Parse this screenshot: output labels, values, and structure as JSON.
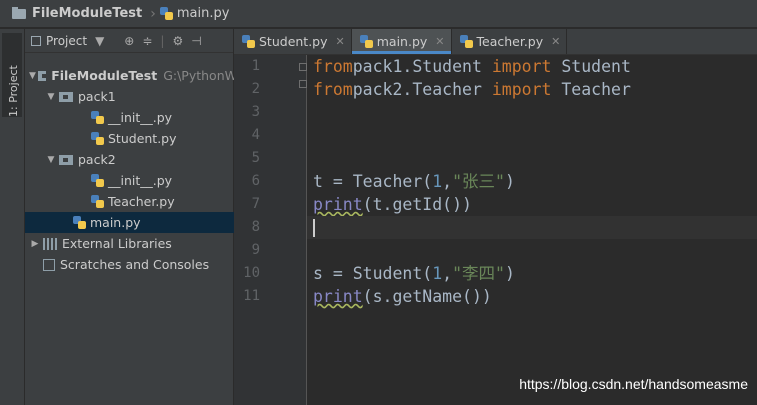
{
  "breadcrumb": {
    "project": "FileModuleTest",
    "file": "main.py"
  },
  "toolstrip": {
    "project_tab": "1: Project"
  },
  "panel": {
    "title": "Project",
    "tree": [
      {
        "label": "FileModuleTest",
        "hint": "G:\\PythonW",
        "type": "root"
      },
      {
        "label": "pack1",
        "type": "package"
      },
      {
        "label": "__init__.py",
        "type": "file"
      },
      {
        "label": "Student.py",
        "type": "file"
      },
      {
        "label": "pack2",
        "type": "package"
      },
      {
        "label": "__init__.py",
        "type": "file"
      },
      {
        "label": "Teacher.py",
        "type": "file"
      },
      {
        "label": "main.py",
        "type": "file",
        "selected": true
      },
      {
        "label": "External Libraries",
        "type": "libraries"
      },
      {
        "label": "Scratches and Consoles",
        "type": "scratches"
      }
    ]
  },
  "tabs": [
    {
      "label": "Student.py",
      "active": false
    },
    {
      "label": "main.py",
      "active": true
    },
    {
      "label": "Teacher.py",
      "active": false
    }
  ],
  "editor": {
    "line_numbers": [
      "1",
      "2",
      "3",
      "4",
      "5",
      "6",
      "7",
      "8",
      "9",
      "10",
      "11"
    ],
    "current_line": 8,
    "lines": [
      [
        [
          "kw",
          "from"
        ],
        [
          "",
          "pack1.Student "
        ],
        [
          "kw",
          "import"
        ],
        [
          "",
          " Student"
        ]
      ],
      [
        [
          "kw",
          "from"
        ],
        [
          "",
          "pack2.Teacher "
        ],
        [
          "kw",
          "import"
        ],
        [
          "",
          " Teacher"
        ]
      ],
      [],
      [],
      [],
      [
        [
          "",
          "t = Teacher("
        ],
        [
          "num",
          "1"
        ],
        [
          "",
          ","
        ],
        [
          "str",
          "\"张三\""
        ],
        [
          "",
          ")"
        ]
      ],
      [
        [
          "bi",
          "print"
        ],
        [
          "",
          "(t.getId())"
        ]
      ],
      [],
      [],
      [
        [
          "",
          "s = Student("
        ],
        [
          "num",
          "1"
        ],
        [
          "",
          ","
        ],
        [
          "str",
          "\"李四\""
        ],
        [
          "",
          ")"
        ]
      ],
      [
        [
          "bi",
          "print"
        ],
        [
          "",
          "(s.getName())"
        ]
      ]
    ]
  },
  "watermark": "https://blog.csdn.net/handsomeasme",
  "colors": {
    "keyword": "#cc7832",
    "string": "#6a8759",
    "number": "#6897bb",
    "builtin": "#8888c6",
    "selection": "#0d293e",
    "tab_accent": "#4a88c7"
  }
}
